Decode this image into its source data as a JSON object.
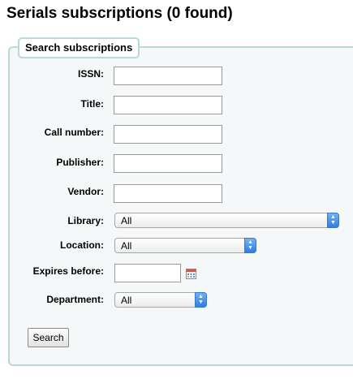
{
  "page": {
    "title": "Serials subscriptions (0 found)"
  },
  "search_form": {
    "legend": "Search subscriptions",
    "fields": {
      "issn": {
        "label": "ISSN:",
        "value": ""
      },
      "title": {
        "label": "Title:",
        "value": ""
      },
      "call_number": {
        "label": "Call number:",
        "value": ""
      },
      "publisher": {
        "label": "Publisher:",
        "value": ""
      },
      "vendor": {
        "label": "Vendor:",
        "value": ""
      },
      "library": {
        "label": "Library:",
        "selected": "All"
      },
      "location": {
        "label": "Location:",
        "selected": "All"
      },
      "expires_before": {
        "label": "Expires before:",
        "value": "",
        "icon": "calendar-icon"
      },
      "department": {
        "label": "Department:",
        "selected": "All"
      }
    },
    "submit_label": "Search"
  },
  "colors": {
    "fieldset_border": "#b9d8d9",
    "fieldset_background": "#f4f8f9",
    "select_arrow": "#2c7fe6"
  }
}
